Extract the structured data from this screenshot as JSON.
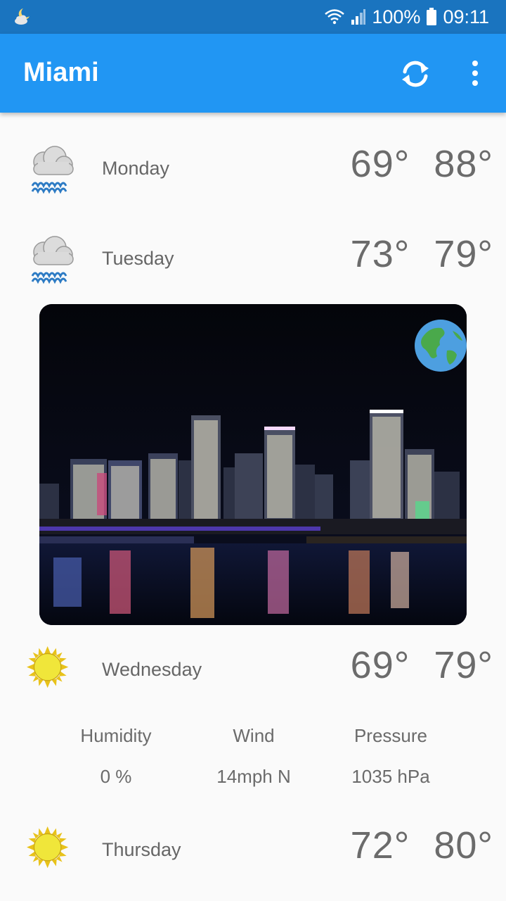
{
  "status_bar": {
    "battery": "100%",
    "time": "09:11"
  },
  "app_bar": {
    "title": "Miami",
    "icons": [
      "refresh-icon",
      "more-vert-icon"
    ]
  },
  "forecast": [
    {
      "day": "Monday",
      "low": "69°",
      "high": "88°",
      "icon": "rain-cloud"
    },
    {
      "day": "Tuesday",
      "low": "73°",
      "high": "79°",
      "icon": "rain-cloud"
    },
    {
      "day": "Wednesday",
      "low": "69°",
      "high": "79°",
      "icon": "sun"
    },
    {
      "day": "Thursday",
      "low": "72°",
      "high": "80°",
      "icon": "sun"
    }
  ],
  "details": {
    "humidity_label": "Humidity",
    "humidity_value": "0 %",
    "wind_label": "Wind",
    "wind_value": "14mph N",
    "pressure_label": "Pressure",
    "pressure_value": "1035 hPa"
  },
  "colors": {
    "status_bar": "#1a74bf",
    "app_bar": "#2196f3",
    "background": "#fafafa",
    "text": "#6b6b6b"
  }
}
